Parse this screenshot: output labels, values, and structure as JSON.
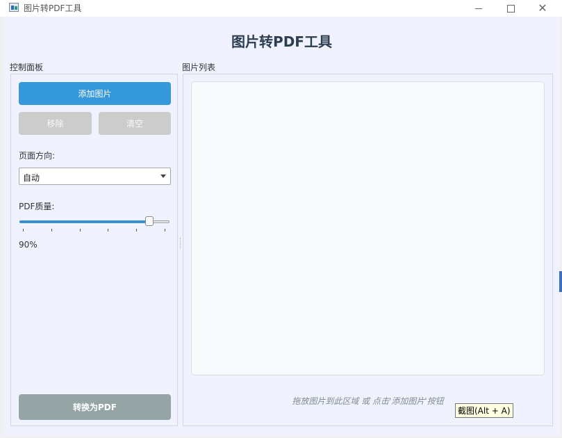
{
  "window": {
    "title": "图片转PDF工具",
    "controls": {
      "minimize": "minimize",
      "maximize": "maximize",
      "close": "✕"
    }
  },
  "header": {
    "title": "图片转PDF工具"
  },
  "control_panel": {
    "label": "控制面板",
    "add_button": "添加图片",
    "remove_button": "移除",
    "clear_button": "清空",
    "orientation_label": "页面方向:",
    "orientation_value": "自动",
    "quality_label": "PDF质量:",
    "quality_percent": 90,
    "quality_text": "90%",
    "convert_button": "转换为PDF"
  },
  "image_panel": {
    "label": "图片列表",
    "hint": "拖放图片到此区域 或 点击'添加图片'按钮"
  },
  "tooltip": {
    "text": "截图(Alt + A)"
  },
  "colors": {
    "accent": "#3498db",
    "disabled": "#cccccc",
    "convert": "#95a5a6",
    "title": "#2c3e50",
    "background": "#f0f2ff"
  }
}
